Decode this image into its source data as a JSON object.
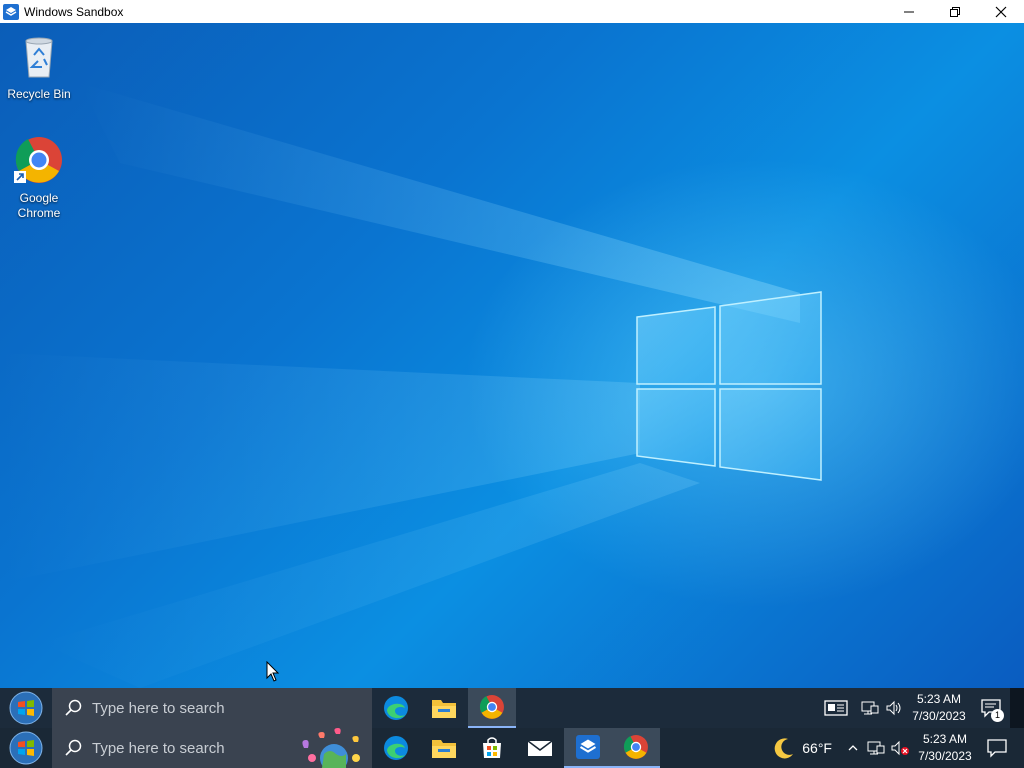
{
  "window": {
    "title": "Windows Sandbox"
  },
  "desktop": {
    "icons": [
      {
        "label": "Recycle Bin"
      },
      {
        "label": "Google Chrome"
      }
    ]
  },
  "taskbar_inner": {
    "search_placeholder": "Type here to search",
    "apps": [
      "edge-icon",
      "file-explorer-icon",
      "chrome-icon"
    ],
    "clock_time": "5:23 AM",
    "clock_date": "7/30/2023",
    "notification_count": "1"
  },
  "taskbar_outer": {
    "search_placeholder": "Type here to search",
    "apps": [
      "edge-icon",
      "file-explorer-icon",
      "store-icon",
      "mail-icon",
      "sandbox-icon",
      "chrome-icon"
    ],
    "weather_temp": "66°F",
    "clock_time": "5:23 AM",
    "clock_date": "7/30/2023"
  },
  "colors": {
    "desktop_accent": "#0a74d0",
    "taskbar_bg": "#1c2b3b",
    "search_bg": "#3a4350"
  }
}
